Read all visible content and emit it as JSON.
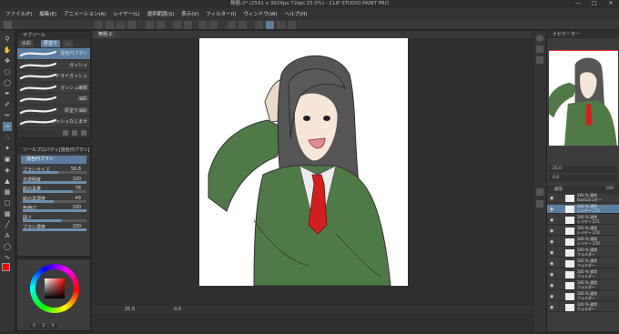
{
  "window": {
    "title": "無題-2* (2591 x 3624px 72dpi 25.0%) - CLIP STUDIO PAINT PRO",
    "buttons": [
      "—",
      "□",
      "✕"
    ]
  },
  "menu": [
    "ファイル(F)",
    "編集(E)",
    "アニメーション(A)",
    "レイヤー(L)",
    "選択範囲(S)",
    "表示(V)",
    "フィルター(I)",
    "ウィンドウ(W)",
    "ヘルプ(H)"
  ],
  "subtool": {
    "header": "サブツール",
    "tabs": [
      "水彩",
      "厚塗り",
      "…"
    ],
    "brushes": [
      "混色円ブラシ",
      "ガッシュ",
      "ドライガッシュ",
      "ガッシュ縁部",
      "油彩",
      "厚塗り油彩",
      "ガッシュなじませ",
      "かすれなじませ"
    ]
  },
  "toolprop": {
    "header": "ツールプロパティ[混色円ブラシ]",
    "selected": "混色円ブラシ",
    "rows": [
      {
        "label": "ブラシサイズ",
        "value": "56.8",
        "fill": 0.55
      },
      {
        "label": "不透明度",
        "value": "100",
        "fill": 1.0
      },
      {
        "label": "絵の具量",
        "value": "78",
        "fill": 0.78
      },
      {
        "label": "絵の具濃度",
        "value": "49",
        "fill": 0.49
      },
      {
        "label": "色伸び",
        "value": "100",
        "fill": 1.0
      },
      {
        "label": "硬さ",
        "value": "",
        "fill": 0.6
      },
      {
        "label": "ブラシ濃度",
        "value": "100",
        "fill": 1.0
      }
    ]
  },
  "color": {
    "values": [
      "0",
      "0",
      "0"
    ],
    "main": "#ff0000"
  },
  "canvas": {
    "tab": "無題-2",
    "zoom": "25.0",
    "angle": "0.0"
  },
  "navigator": {
    "header": "ナビゲーター",
    "zoom": "25.0",
    "angle": "0.0"
  },
  "layers": {
    "header": "レイヤー",
    "blend": "通常",
    "opacity": "100",
    "items": [
      {
        "pct": "100 %",
        "mode": "通常",
        "name": "face1のコピー"
      },
      {
        "pct": "100 %",
        "mode": "通常",
        "name": "レイヤー 273"
      },
      {
        "pct": "100 %",
        "mode": "通常",
        "name": "レイヤー 271"
      },
      {
        "pct": "100 %",
        "mode": "通常",
        "name": "レイヤー 272"
      },
      {
        "pct": "100 %",
        "mode": "通常",
        "name": "レイヤー 270"
      },
      {
        "pct": "100 %",
        "mode": "通常",
        "name": "フォルダー"
      },
      {
        "pct": "100 %",
        "mode": "通常",
        "name": "フォルダー"
      },
      {
        "pct": "100 %",
        "mode": "通常",
        "name": "フォルダー"
      },
      {
        "pct": "100 %",
        "mode": "通常",
        "name": "フォルダー"
      },
      {
        "pct": "100 %",
        "mode": "通常",
        "name": "フォルダー"
      },
      {
        "pct": "100 %",
        "mode": "通常",
        "name": "フォルダー"
      }
    ]
  }
}
